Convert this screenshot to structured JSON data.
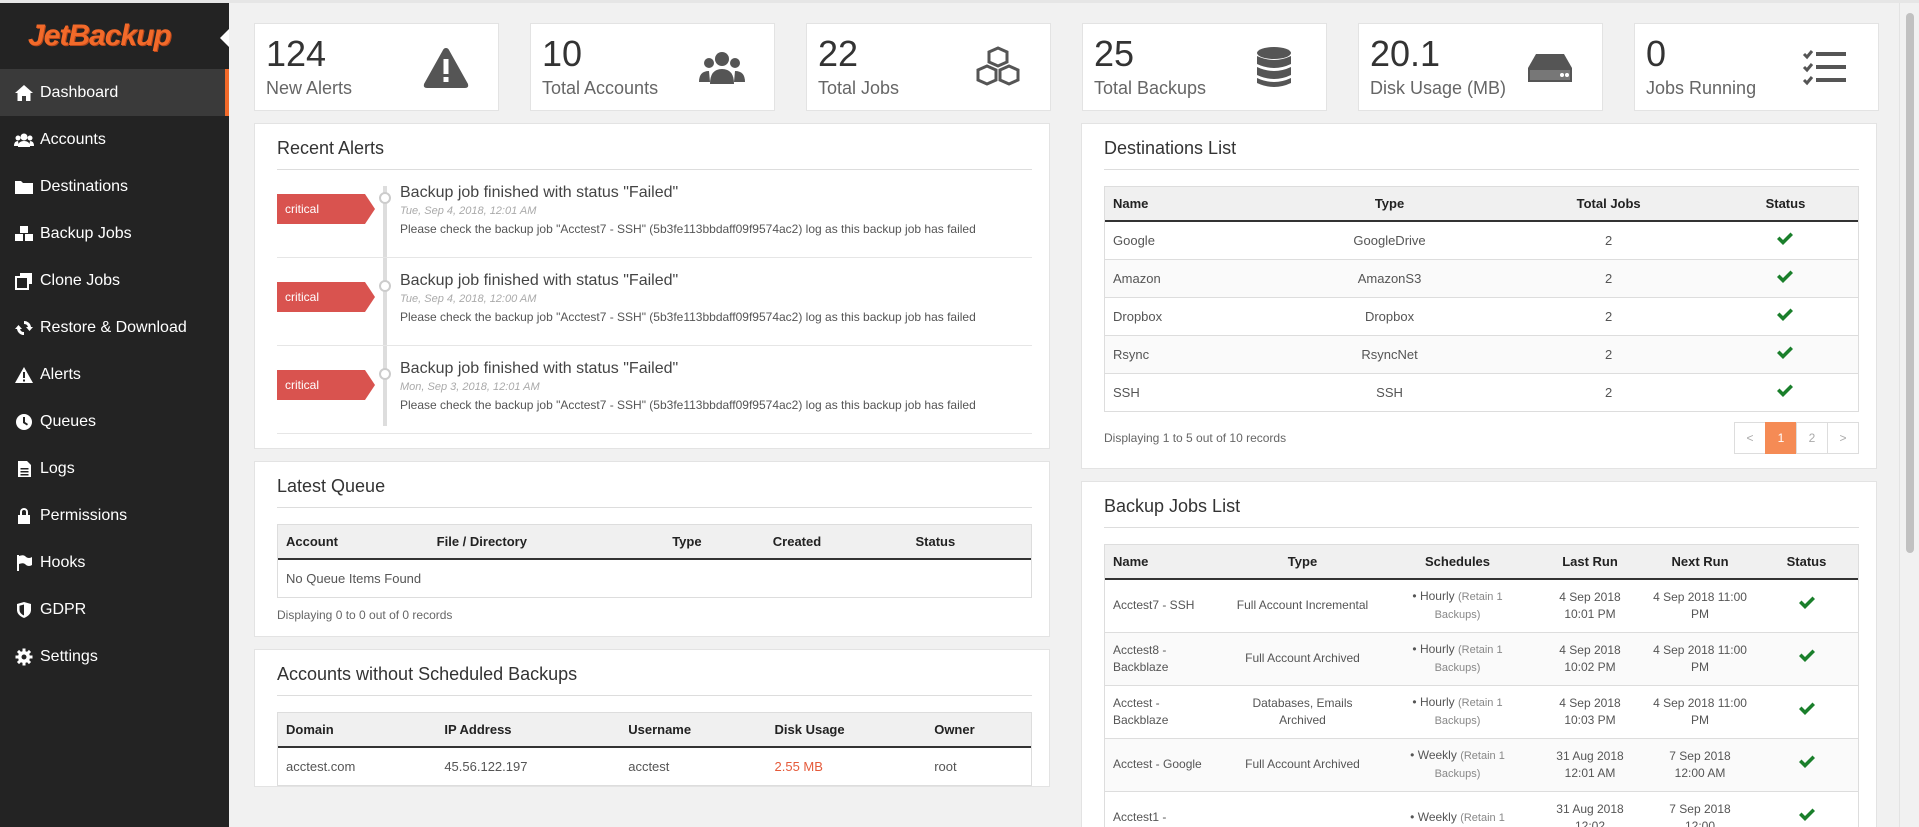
{
  "brand": {
    "logo_text": "JetBackup"
  },
  "sidebar": {
    "items": [
      {
        "label": "Dashboard",
        "icon": "dashboard-icon"
      },
      {
        "label": "Accounts",
        "icon": "users-icon"
      },
      {
        "label": "Destinations",
        "icon": "folder-icon"
      },
      {
        "label": "Backup Jobs",
        "icon": "cubes-icon"
      },
      {
        "label": "Clone Jobs",
        "icon": "clone-icon"
      },
      {
        "label": "Restore & Download",
        "icon": "refresh-icon"
      },
      {
        "label": "Alerts",
        "icon": "warning-icon"
      },
      {
        "label": "Queues",
        "icon": "clock-icon"
      },
      {
        "label": "Logs",
        "icon": "file-icon"
      },
      {
        "label": "Permissions",
        "icon": "lock-icon"
      },
      {
        "label": "Hooks",
        "icon": "flag-icon"
      },
      {
        "label": "GDPR",
        "icon": "shield-icon"
      },
      {
        "label": "Settings",
        "icon": "gear-icon"
      }
    ]
  },
  "stats": [
    {
      "value": "124",
      "label": "New Alerts",
      "icon": "warning-triangle-icon"
    },
    {
      "value": "10",
      "label": "Total Accounts",
      "icon": "users-icon"
    },
    {
      "value": "22",
      "label": "Total Jobs",
      "icon": "cubes-icon"
    },
    {
      "value": "25",
      "label": "Total Backups",
      "icon": "database-icon"
    },
    {
      "value": "20.1",
      "label": "Disk Usage (MB)",
      "icon": "hdd-icon"
    },
    {
      "value": "0",
      "label": "Jobs Running",
      "icon": "tasks-icon"
    }
  ],
  "recent_alerts": {
    "title": "Recent Alerts",
    "items": [
      {
        "level": "critical",
        "title": "Backup job finished with status \"Failed\"",
        "date": "Tue, Sep 4, 2018, 12:01 AM",
        "message": "Please check the backup job \"Acctest7 - SSH\" (5b3fe113bbdaff09f9574ac2) log as this backup job has failed"
      },
      {
        "level": "critical",
        "title": "Backup job finished with status \"Failed\"",
        "date": "Tue, Sep 4, 2018, 12:00 AM",
        "message": "Please check the backup job \"Acctest7 - SSH\" (5b3fe113bbdaff09f9574ac2) log as this backup job has failed"
      },
      {
        "level": "critical",
        "title": "Backup job finished with status \"Failed\"",
        "date": "Mon, Sep 3, 2018, 12:01 AM",
        "message": "Please check the backup job \"Acctest7 - SSH\" (5b3fe113bbdaff09f9574ac2) log as this backup job has failed"
      }
    ]
  },
  "latest_queue": {
    "title": "Latest Queue",
    "columns": [
      "Account",
      "File / Directory",
      "Type",
      "Created",
      "Status"
    ],
    "empty": "No Queue Items Found",
    "footer": "Displaying 0 to 0 out of 0 records"
  },
  "accounts_without": {
    "title": "Accounts without Scheduled Backups",
    "columns": [
      "Domain",
      "IP Address",
      "Username",
      "Disk Usage",
      "Owner"
    ],
    "rows": [
      {
        "domain": "acctest.com",
        "ip": "45.56.122.197",
        "username": "acctest",
        "disk": "2.55 MB",
        "owner": "root"
      }
    ]
  },
  "destinations": {
    "title": "Destinations List",
    "columns": [
      "Name",
      "Type",
      "Total Jobs",
      "Status"
    ],
    "rows": [
      {
        "name": "Google",
        "type": "GoogleDrive",
        "jobs": "2"
      },
      {
        "name": "Amazon",
        "type": "AmazonS3",
        "jobs": "2"
      },
      {
        "name": "Dropbox",
        "type": "Dropbox",
        "jobs": "2"
      },
      {
        "name": "Rsync",
        "type": "RsyncNet",
        "jobs": "2"
      },
      {
        "name": "SSH",
        "type": "SSH",
        "jobs": "2"
      }
    ],
    "footer": "Displaying 1 to 5 out of 10 records",
    "pager": {
      "prev": "<",
      "p1": "1",
      "p2": "2",
      "next": ">"
    }
  },
  "backup_jobs": {
    "title": "Backup Jobs List",
    "columns": [
      "Name",
      "Type",
      "Schedules",
      "Last Run",
      "Next Run",
      "Status"
    ],
    "rows": [
      {
        "name": "Acctest7 - SSH",
        "type": "Full Account Incremental",
        "schedule": "Hourly",
        "retain": "(Retain 1 Backups)",
        "last": "4 Sep 2018 10:01 PM",
        "next": "4 Sep 2018 11:00 PM"
      },
      {
        "name": "Acctest8 - Backblaze",
        "type": "Full Account Archived",
        "schedule": "Hourly",
        "retain": "(Retain 1 Backups)",
        "last": "4 Sep 2018 10:02 PM",
        "next": "4 Sep 2018 11:00 PM"
      },
      {
        "name": "Acctest - Backblaze",
        "type": "Databases, Emails Archived",
        "schedule": "Hourly",
        "retain": "(Retain 1 Backups)",
        "last": "4 Sep 2018 10:03 PM",
        "next": "4 Sep 2018 11:00 PM"
      },
      {
        "name": "Acctest - Google",
        "type": "Full Account Archived",
        "schedule": "Weekly",
        "retain": "(Retain 1 Backups)",
        "last": "31 Aug 2018 12:01 AM",
        "next": "7 Sep 2018 12:00 AM"
      },
      {
        "name": "Acctest1 -",
        "type": "",
        "schedule": "Weekly",
        "retain": "(Retain 1",
        "last": "31 Aug 2018 12:02",
        "next": "7 Sep 2018 12:00"
      }
    ]
  },
  "colors": {
    "accent": "#f26a2a",
    "critical": "#d9534f",
    "ok": "#1a7f2b",
    "sidebar_bg": "#232323"
  }
}
